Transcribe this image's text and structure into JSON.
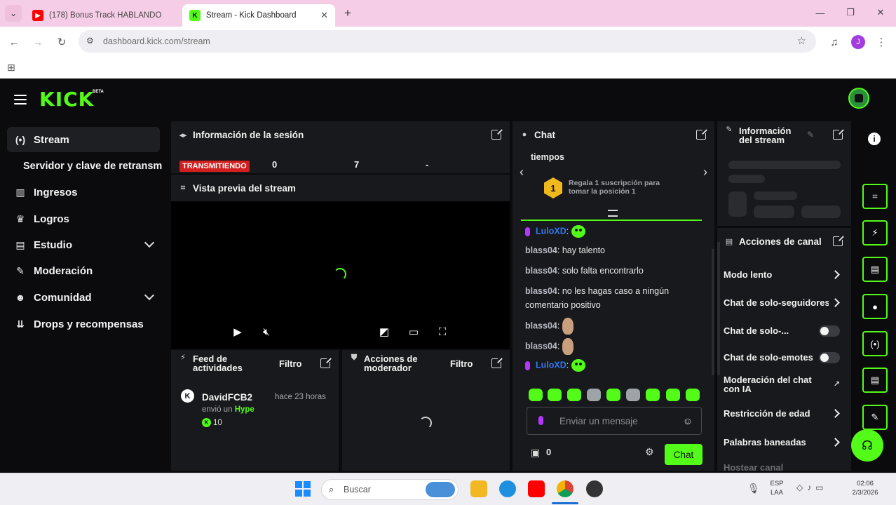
{
  "browser": {
    "tabs": [
      {
        "label": "(178) Bonus Track HABLANDO",
        "favicon": "youtube-icon",
        "color": "#ff0000"
      },
      {
        "label": "Stream - Kick Dashboard",
        "favicon": "kick-icon",
        "color": "#53fc18"
      }
    ],
    "url": "dashboard.kick.com/stream",
    "profile_initial": "J"
  },
  "header": {
    "logo": "KICK",
    "beta": "BETA"
  },
  "sidebar": {
    "items": [
      {
        "label": "Stream",
        "icon": "broadcast-icon",
        "active": true
      },
      {
        "label": "Ingresos",
        "icon": "bar-chart-icon"
      },
      {
        "label": "Logros",
        "icon": "trophy-icon"
      },
      {
        "label": "Estudio",
        "icon": "studio-icon",
        "expandable": true
      },
      {
        "label": "Moderación",
        "icon": "wrench-icon"
      },
      {
        "label": "Comunidad",
        "icon": "people-icon",
        "expandable": true
      },
      {
        "label": "Drops y recompensas",
        "icon": "drops-icon"
      }
    ],
    "sub_item": "Servidor y clave de retransm"
  },
  "session": {
    "title": "Información de la sesión",
    "badge": "TRANSMITIENDO",
    "stats": [
      "0",
      "7",
      "-"
    ]
  },
  "preview": {
    "title": "Vista previa del stream"
  },
  "feed": {
    "title": "Feed de actividades",
    "filter": "Filtro",
    "event": {
      "user": "DavidFCB2",
      "time": "hace 23 horas",
      "action": "envió un",
      "item": "Hype",
      "amount": "10",
      "avatar": "K"
    }
  },
  "modactions": {
    "title": "Acciones de moderador",
    "filter": "Filtro"
  },
  "chat": {
    "title": "Chat",
    "pinned_fragment": "tiempos",
    "gift_rank": "1",
    "gift_text": "Regala 1 suscripción para tomar la posición 1",
    "messages": [
      {
        "user": "LuloXD",
        "text": "",
        "emote": "green",
        "mic": true,
        "blue": true
      },
      {
        "user": "blass04",
        "text": " hay talento"
      },
      {
        "user": "blass04",
        "text": " solo falta encontrarlo"
      },
      {
        "user": "blass04",
        "text": " no les hagas caso a ningún"
      },
      {
        "user": "",
        "text": "comentario positivo"
      },
      {
        "user": "blass04",
        "text": "",
        "emote": "face"
      },
      {
        "user": "blass04",
        "text": "",
        "emote": "face"
      },
      {
        "user": "LuloXD",
        "text": "",
        "emote": "green",
        "mic": true,
        "blue": true
      }
    ],
    "input_placeholder": "Enviar un mensaje",
    "viewer_count": "0",
    "send_label": "Chat"
  },
  "stream_info": {
    "title": "Información del stream"
  },
  "channel_actions": {
    "title": "Acciones de canal",
    "rows": [
      {
        "label": "Modo lento",
        "control": "chevron"
      },
      {
        "label": "Chat de solo-seguidores",
        "control": "chevron"
      },
      {
        "label": "Chat de solo-...",
        "control": "toggle"
      },
      {
        "label": "Chat de solo-emotes",
        "control": "toggle"
      },
      {
        "label": "Moderación del chat con IA",
        "control": "chart"
      },
      {
        "label": "Restricción de edad",
        "control": "chevron"
      },
      {
        "label": "Palabras baneadas",
        "control": "chevron"
      },
      {
        "label": "Hostear canal",
        "control": "none"
      }
    ]
  },
  "taskbar": {
    "search_placeholder": "Buscar",
    "lang_top": "ESP",
    "lang_bottom": "LAA",
    "time": "02:06",
    "date": "2/3/2026"
  },
  "colors": {
    "accent": "#53fc18",
    "live": "#d21e1e",
    "panel": "#18191c",
    "bg": "#0b0b0d"
  }
}
